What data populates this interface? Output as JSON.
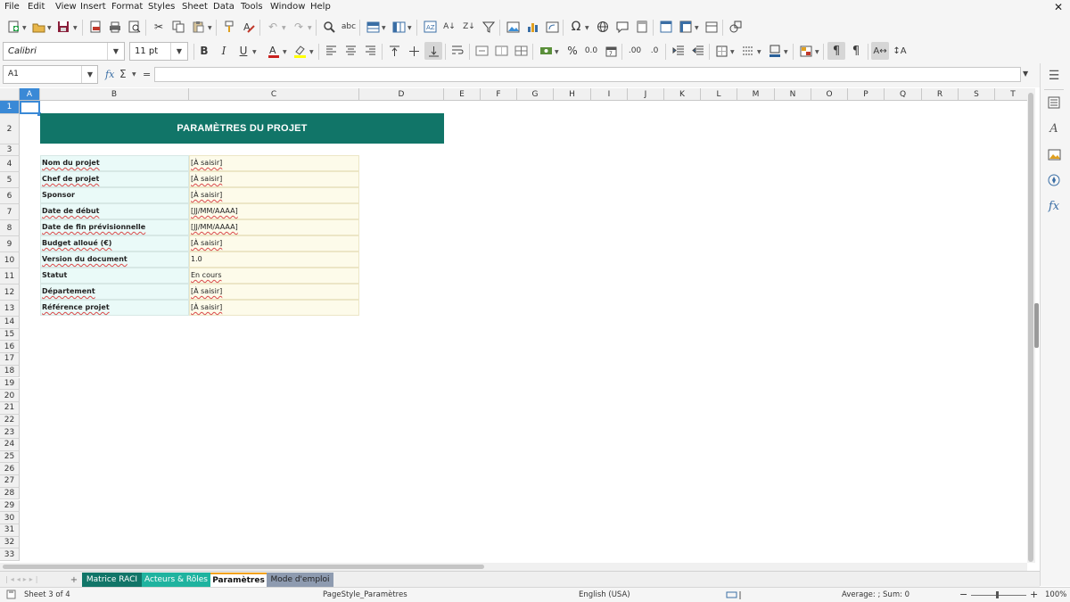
{
  "menu": [
    "File",
    "Edit",
    "View",
    "Insert",
    "Format",
    "Styles",
    "Sheet",
    "Data",
    "Tools",
    "Window",
    "Help"
  ],
  "close_glyph": "✕",
  "toolbar": {
    "font_name": "Calibri",
    "font_size": "11 pt",
    "bold": "B",
    "italic": "I",
    "underline": "U",
    "percent": "%",
    "number_format": "0.0",
    "decimal_add": ".00",
    "decimal_remove": ".0"
  },
  "formula_bar": {
    "cell_ref": "A1",
    "fx": "fx",
    "sigma": "Σ",
    "equals": "=",
    "content": ""
  },
  "sheet": {
    "columns": [
      {
        "label": "A",
        "selected": true
      },
      {
        "label": "B"
      },
      {
        "label": "C"
      },
      {
        "label": "D"
      },
      {
        "label": "E"
      },
      {
        "label": "F"
      },
      {
        "label": "G"
      },
      {
        "label": "H"
      },
      {
        "label": "I"
      },
      {
        "label": "J"
      },
      {
        "label": "K"
      },
      {
        "label": "L"
      },
      {
        "label": "M"
      },
      {
        "label": "N"
      },
      {
        "label": "O"
      },
      {
        "label": "P"
      },
      {
        "label": "Q"
      },
      {
        "label": "R"
      },
      {
        "label": "S"
      },
      {
        "label": "T"
      }
    ],
    "row_labels": [
      "1",
      "2",
      "3",
      "4",
      "5",
      "6",
      "7",
      "8",
      "9",
      "10",
      "11",
      "12",
      "13",
      "14",
      "15",
      "16",
      "17",
      "18",
      "19",
      "20",
      "21",
      "22",
      "23",
      "24",
      "25",
      "26",
      "27",
      "28",
      "29",
      "30",
      "31",
      "32",
      "33"
    ],
    "title": "PARAMÈTRES DU PROJET",
    "fields": [
      {
        "label": "Nom du projet",
        "value": "[À saisir]"
      },
      {
        "label": "Chef de projet",
        "value": "[À saisir]"
      },
      {
        "label": "Sponsor",
        "value": "[À saisir]"
      },
      {
        "label": "Date de début",
        "value": "[JJ/MM/AAAA]"
      },
      {
        "label": "Date de fin prévisionnelle",
        "value": "[JJ/MM/AAAA]"
      },
      {
        "label": "Budget alloué (€)",
        "value": "[À saisir]"
      },
      {
        "label": "Version du document",
        "value": "1.0"
      },
      {
        "label": "Statut",
        "value": "En cours"
      },
      {
        "label": "Département",
        "value": "[À saisir]"
      },
      {
        "label": "Référence projet",
        "value": "[À saisir]"
      }
    ]
  },
  "tabs": [
    {
      "label": "Matrice RACI",
      "bg": "#117568",
      "fg": "#ffffff",
      "active": false
    },
    {
      "label": "Acteurs & Rôles",
      "bg": "#1fb39f",
      "fg": "#ffffff",
      "active": false
    },
    {
      "label": "Paramètres",
      "bg": "#ffffff",
      "fg": "#111111",
      "active": true,
      "accent": "#f3a21b"
    },
    {
      "label": "Mode d'emploi",
      "bg": "#8e9bb0",
      "fg": "#222222",
      "active": false
    }
  ],
  "add_tab": "+",
  "status": {
    "sheet": "Sheet 3 of 4",
    "page_style": "PageStyle_Paramètres",
    "language": "English (USA)",
    "sum": "Average: ; Sum: 0",
    "zoom": "100%",
    "zoom_minus": "−",
    "zoom_plus": "+"
  },
  "colors": {
    "accent_teal": "#117568",
    "label_fill": "#eafaf8",
    "value_fill": "#fdfbea",
    "selection": "#3a89d6"
  }
}
